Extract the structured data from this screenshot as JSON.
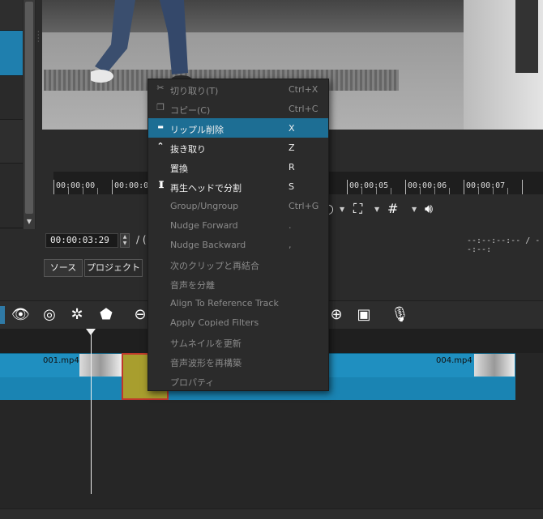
{
  "timecode": {
    "current": "00:00:03:29",
    "separator": "/ (",
    "total": "--:--:--:-- / --:--:"
  },
  "tabs": {
    "source": "ソース",
    "project": "プロジェクト"
  },
  "ruler": {
    "ticks": [
      "00:00:00",
      "00:00:01",
      "00:00:05",
      "00:00:06",
      "00:00:07"
    ]
  },
  "clips": {
    "first": "001.mp4",
    "last": "004.mp4"
  },
  "menu": {
    "items": [
      {
        "label": "切り取り(T)",
        "shortcut": "Ctrl+X",
        "icon": "scissors-icon",
        "enabled": false,
        "highlighted": false
      },
      {
        "label": "コピー(C)",
        "shortcut": "Ctrl+C",
        "icon": "copy-icon",
        "enabled": false,
        "highlighted": false
      },
      {
        "label": "リップル削除",
        "shortcut": "X",
        "icon": "minus-icon",
        "enabled": true,
        "highlighted": true
      },
      {
        "label": "抜き取り",
        "shortcut": "Z",
        "icon": "chevron-up-icon",
        "enabled": true,
        "highlighted": false
      },
      {
        "label": "置換",
        "shortcut": "R",
        "icon": "",
        "enabled": true,
        "highlighted": false
      },
      {
        "label": "再生ヘッドで分割",
        "shortcut": "S",
        "icon": "split-icon",
        "enabled": true,
        "highlighted": false
      },
      {
        "label": "Group/Ungroup",
        "shortcut": "Ctrl+G",
        "icon": "",
        "enabled": false,
        "highlighted": false
      },
      {
        "label": "Nudge Forward",
        "shortcut": ".",
        "icon": "",
        "enabled": false,
        "highlighted": false
      },
      {
        "label": "Nudge Backward",
        "shortcut": ",",
        "icon": "",
        "enabled": false,
        "highlighted": false
      },
      {
        "label": "次のクリップと再結合",
        "shortcut": "",
        "icon": "",
        "enabled": false,
        "highlighted": false
      },
      {
        "label": "音声を分離",
        "shortcut": "",
        "icon": "",
        "enabled": false,
        "highlighted": false
      },
      {
        "label": "Align To Reference Track",
        "shortcut": "",
        "icon": "",
        "enabled": false,
        "highlighted": false
      },
      {
        "label": "Apply Copied Filters",
        "shortcut": "",
        "icon": "",
        "enabled": false,
        "highlighted": false
      },
      {
        "label": "サムネイルを更新",
        "shortcut": "",
        "icon": "",
        "enabled": false,
        "highlighted": false
      },
      {
        "label": "音声波形を再構築",
        "shortcut": "",
        "icon": "",
        "enabled": false,
        "highlighted": false
      },
      {
        "label": "プロパティ",
        "shortcut": "",
        "icon": "",
        "enabled": false,
        "highlighted": false
      }
    ]
  },
  "colors": {
    "highlight": "#1d6e94",
    "track": "#1f8fc0",
    "selected_clip": "#a89e2e",
    "selection_border": "#c0382b"
  }
}
